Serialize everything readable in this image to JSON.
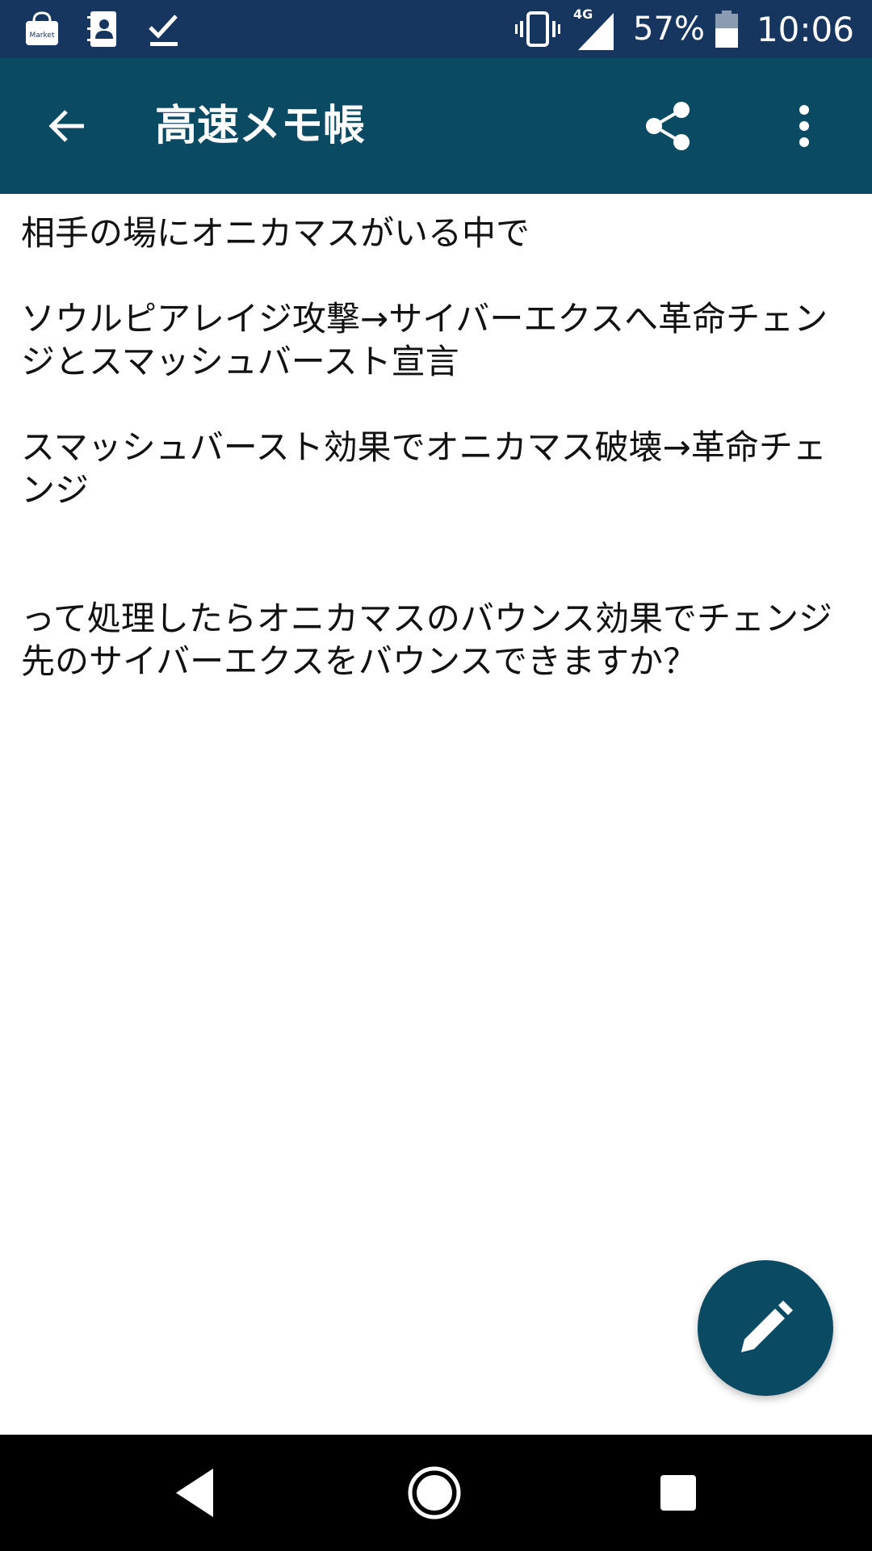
{
  "status_bar": {
    "left_icons": [
      "market-icon",
      "contacts-icon",
      "checkmark-icon"
    ],
    "market_label": "Market",
    "network_type": "4G",
    "battery_percent": "57%",
    "time": "10:06",
    "battery_level": 0.57
  },
  "app_bar": {
    "title": "高速メモ帳",
    "back_icon": "arrow-left-icon",
    "share_icon": "share-icon",
    "more_icon": "more-vert-icon"
  },
  "memo": {
    "paragraphs": [
      "相手の場にオニカマスがいる中で",
      "ソウルピアレイジ攻撃→サイバーエクスへ革命チェンジとスマッシュバースト宣言",
      "スマッシュバースト効果でオニカマス破壊→革命チェンジ",
      "って処理したらオニカマスのバウンス効果でチェンジ先のサイバーエクスをバウンスできますか？"
    ]
  },
  "fab": {
    "icon": "pencil-icon"
  },
  "nav_bar": {
    "icons": [
      "nav-back-icon",
      "nav-home-icon",
      "nav-recents-icon"
    ]
  },
  "colors": {
    "status_bar": "#163660",
    "app_bar": "#0b4a63",
    "fab": "#0b4a63",
    "nav_bar": "#000000",
    "text": "#111111"
  }
}
